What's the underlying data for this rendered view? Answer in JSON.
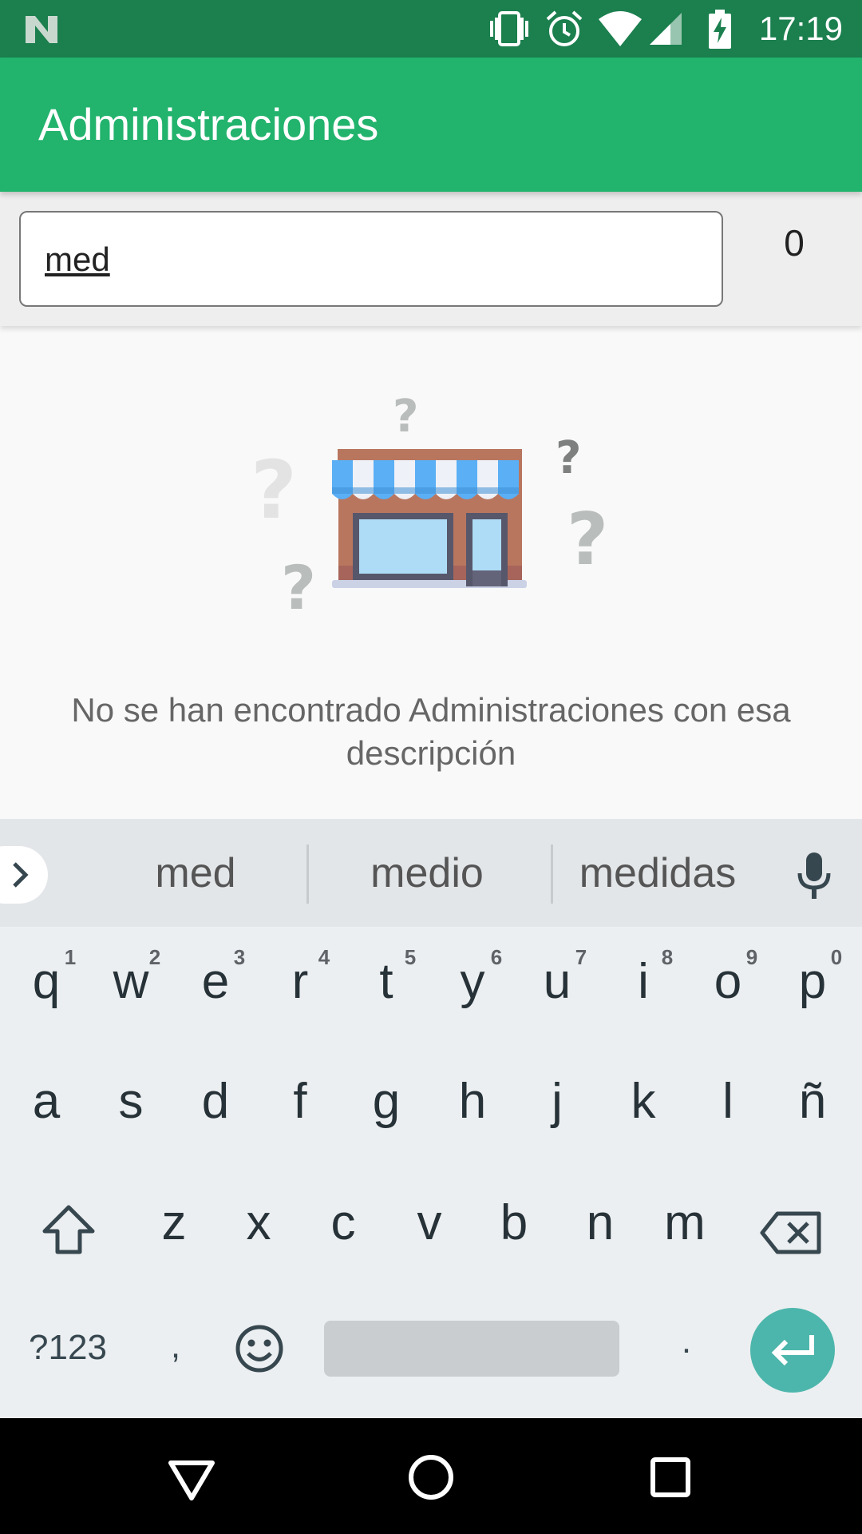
{
  "status_bar": {
    "time": "17:19",
    "icons": [
      "n-logo-icon",
      "vibrate-icon",
      "alarm-icon",
      "wifi-icon",
      "signal-icon",
      "battery-charging-icon"
    ]
  },
  "app_bar": {
    "title": "Administraciones"
  },
  "search": {
    "value": "med",
    "result_count": "0"
  },
  "empty_state": {
    "illustration": "store-icon",
    "message": "No se han encontrado Administraciones con esa descripción"
  },
  "keyboard": {
    "suggestions": [
      "med",
      "medio",
      "medidas"
    ],
    "row1": [
      "q",
      "w",
      "e",
      "r",
      "t",
      "y",
      "u",
      "i",
      "o",
      "p"
    ],
    "row1_hints": [
      "1",
      "2",
      "3",
      "4",
      "5",
      "6",
      "7",
      "8",
      "9",
      "0"
    ],
    "row2": [
      "a",
      "s",
      "d",
      "f",
      "g",
      "h",
      "j",
      "k",
      "l",
      "ñ"
    ],
    "row3": [
      "z",
      "x",
      "c",
      "v",
      "b",
      "n",
      "m"
    ],
    "symbols_label": "?123",
    "comma": ",",
    "period": ".",
    "enter_color": "#4db6ac"
  },
  "colors": {
    "status_bar": "#1b7f4e",
    "app_bar": "#22b36d"
  }
}
